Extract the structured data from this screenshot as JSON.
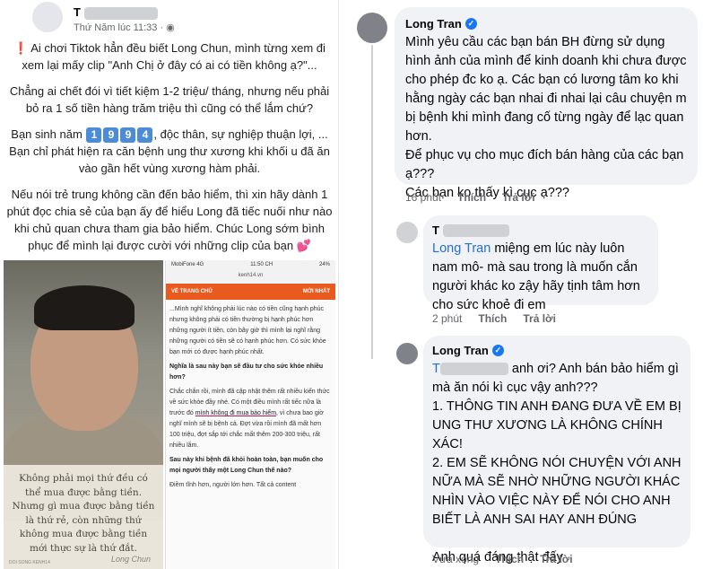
{
  "left": {
    "post": {
      "author_initial": "T",
      "timestamp": "Thứ Năm lúc 11:33",
      "privacy_icon": "globe-icon",
      "p1_excl": "❗",
      "p1": "Ai chơi Tiktok hẳn đều biết Long Chun, mình từng xem đi xem lại mấy clip \"Anh Chị ở đây có ai có tiền không ạ?\"...",
      "p2": "Chẳng ai chết đói vì tiết kiệm 1-2 triệu/ tháng, nhưng nếu phải bỏ ra 1 số tiền hàng trăm triệu thì cũng có thể lắm chứ?",
      "p3_a": "Bạn sinh năm",
      "p3_digits": [
        "1",
        "9",
        "9",
        "4"
      ],
      "p3_b": ", độc thân, sự nghiệp thuận lợi, ... Bạn chỉ phát hiện ra căn bệnh ung thư xương khi khối u đã ăn vào gần hết vùng xương hàm phải.",
      "p4": "Nếu nói trẻ trung không cần đến bảo hiểm, thì xin hãy dành 1 phút đọc chia sẻ của bạn ấy để hiểu Long đã tiếc nuối như nào khi chủ quan chưa tham gia bảo hiểm. Chúc Long sớm bình phục để mình lại được cười với những clip của bạn",
      "p4_heart": "💕"
    },
    "image1": {
      "caption": "Không phải mọi thứ đều có thể mua được bằng tiền. Nhưng gì mua được bằng tiền là thứ rẻ, còn những thứ không mua được bằng tiền mới thực sự là thứ đắt.",
      "signature": "Long Chun",
      "tiny": "DOI SONG KENH14"
    },
    "image2": {
      "carrier": "MobiFone 4G",
      "time": "11:50 CH",
      "battery": "24%",
      "url": "kenh14.vn",
      "nav_left": "VỀ TRANG CHỦ",
      "nav_right": "MỚI NHẤT",
      "para1": "...Mình nghĩ không phải lúc nào có tiền cũng hạnh phúc nhưng không phải có tiền thường bị hạnh phúc hơn những người ít tiền, còn bây giờ thì mình lại nghĩ rằng những người có tiền sẽ có hạnh phúc hơn. Có sức khỏe bạn mới có được hạnh phúc nhất.",
      "para2": "Nghĩa là sau này bạn sẽ đầu tư cho sức khỏe nhiều hơn?",
      "para3_a": "Chắc chắn rồi, mình đã cập nhật thêm rất nhiều kiến thức về sức khỏe đầy nhé. Có một điều mình rất tiếc nữa là trước đó",
      "para3_hl": "mình không đi mua bảo hiểm",
      "para3_b": ", vì chưa bao giờ nghĩ mình sẽ bị bệnh cả. Đợt vừa rồi mình đã mất hơn 100 triệu, đợt sắp tới chắc mất thêm 200-300 triệu, rất nhiều lắm.",
      "para4": "Sau này khi bệnh đã khỏi hoàn toàn, bạn muốn cho mọi người thấy một Long Chun thế nào?",
      "para5": "Điềm tĩnh hơn, người lớn hơn. Tất cả content"
    }
  },
  "right": {
    "comment1": {
      "name": "Long Tran",
      "text": "Mình yêu cầu các bạn bán BH đừng sử dụng hình ảnh của mình để kinh doanh khi chưa được cho phép đc ko ạ. Các bạn có lương tâm ko khi hằng ngày các bạn nhai đi nhai lại câu chuyện m bị bệnh khi mình đang cố từng ngày để lạc quan hơn.\nĐể phục vụ cho mục đích bán hàng của các bạn ạ???\nCác bạn ko thấy kì cục ạ???",
      "time": "16 phút",
      "like": "Thích",
      "reply": "Trả lời"
    },
    "comment2": {
      "name_initial": "T",
      "mention": "Long Tran",
      "text": " miệng em lúc này luôn nam mô- mà sau trong là muốn cắn người khác ko zậy hãy tịnh tâm hơn cho sức khoẻ đi em",
      "time": "2 phút",
      "like": "Thích",
      "reply": "Trả lời"
    },
    "comment3": {
      "name": "Long Tran",
      "mention_initial": "T",
      "text_a": " anh ơi? Anh bán bảo hiểm gì mà ăn nói kì cục vậy anh???",
      "text_b": "1. THÔNG TIN ANH ĐANG ĐƯA VỀ EM BỊ UNG THƯ XƯƠNG LÀ KHÔNG CHÍNH XÁC!",
      "text_c": "2. EM SẼ KHÔNG NÓI CHUYỆN VỚI ANH NỮA MÀ SẼ NHỜ NHỮNG NGƯỜI KHÁC NHÌN VÀO VIỆC NÀY ĐỂ NÓI CHO ANH BIẾT LÀ ANH SAI HAY ANH ĐÚNG",
      "text_d": "Anh quá đáng thật đấy",
      "time": "Vừa xong",
      "like": "Thích",
      "reply": "Trả lời"
    }
  }
}
